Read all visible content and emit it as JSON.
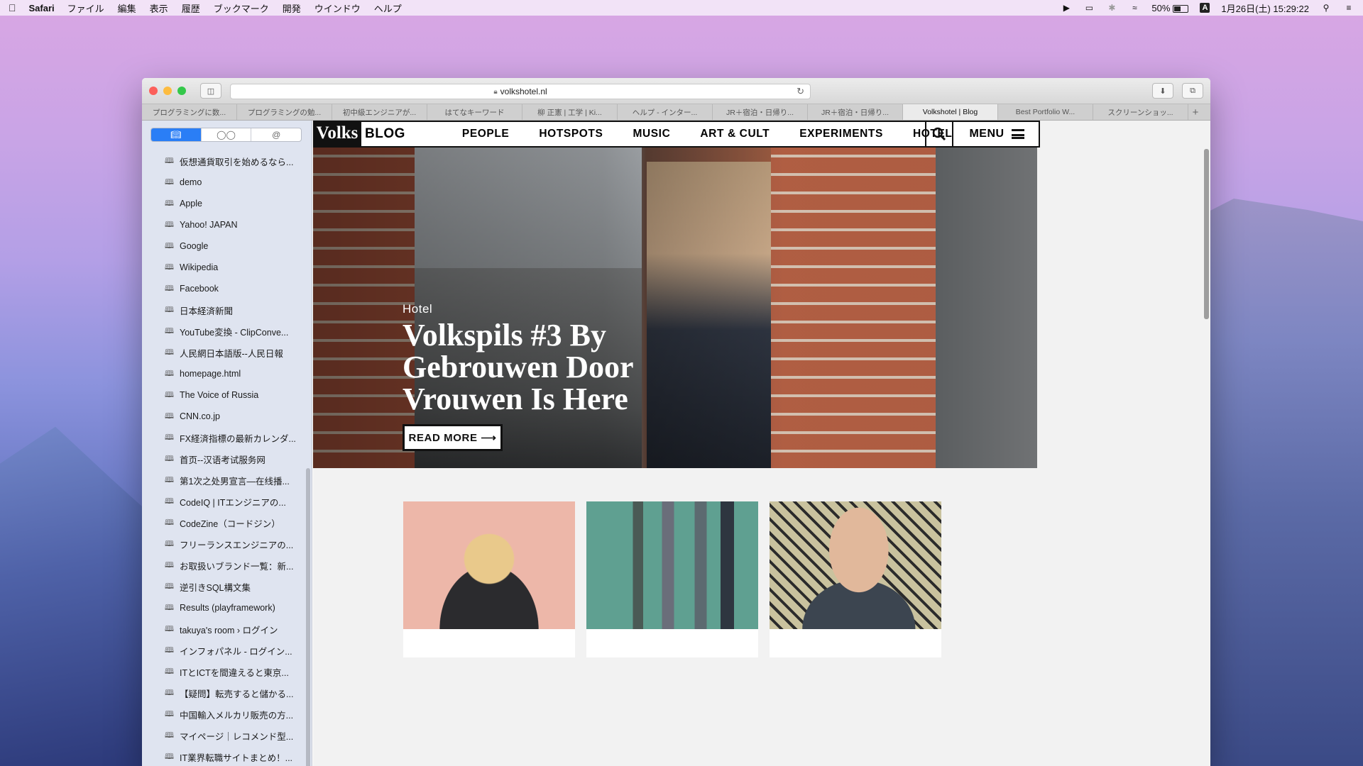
{
  "menubar": {
    "app": "Safari",
    "items": [
      "ファイル",
      "編集",
      "表示",
      "履歴",
      "ブックマーク",
      "開発",
      "ウインドウ",
      "ヘルプ"
    ],
    "battery": "50%",
    "input": "A",
    "datetime": "1月26日(土) 15:29:22"
  },
  "browser": {
    "url": "volkshotel.nl",
    "tabs": [
      "プログラミングに数...",
      "プログラミングの勉...",
      "初中級エンジニアが...",
      "はてなキーワード",
      "柳 正憲 | 工学 | Ki...",
      "ヘルプ - インター...",
      "JR＋宿泊・日帰り...",
      "JR＋宿泊・日帰り...",
      "Volkshotel | Blog",
      "Best Portfolio W...",
      "スクリーンショッ..."
    ],
    "active_tab": 8,
    "new_tab": "+"
  },
  "sidebar": {
    "segments": [
      "bookmarks",
      "reading-list",
      "shared-links"
    ],
    "bookmarks": [
      "仮想通貨取引を始めるなら...",
      "demo",
      "Apple",
      "Yahoo! JAPAN",
      "Google",
      "Wikipedia",
      "Facebook",
      "日本経済新聞",
      "YouTube変換 - ClipConve...",
      "人民網日本語版--人民日報",
      "homepage.html",
      "The Voice of Russia",
      "CNN.co.jp",
      "FX経済指標の最新カレンダ...",
      "首页--汉语考试服务网",
      "第1次之处男宣言―在线播...",
      "CodeIQ | ITエンジニアの...",
      "CodeZine（コードジン）",
      "フリーランスエンジニアの...",
      "お取扱いブランド一覧：新...",
      "逆引きSQL構文集",
      "Results (playframework)",
      "takuya's room › ログイン",
      "インフォパネル - ログイン...",
      "ITとICTを間違えると東京...",
      "【疑問】転売すると儲かる...",
      "中国輸入メルカリ販売の方...",
      "マイページ｜レコメンド型...",
      "IT業界転職サイトまとめ！..."
    ]
  },
  "site": {
    "logo": "Volks",
    "logo_sub": "BLOG",
    "nav": [
      "PEOPLE",
      "HOTSPOTS",
      "MUSIC",
      "ART & CULT",
      "EXPERIMENTS",
      "HOTEL"
    ],
    "menu_label": "MENU",
    "hero": {
      "category": "Hotel",
      "title": "Volkspils #3 By Gebrouwen Door Vrouwen Is Here",
      "cta": "READ MORE ⟶"
    }
  },
  "colors": {
    "accent": "#2a7ef6",
    "ink": "#111111"
  }
}
